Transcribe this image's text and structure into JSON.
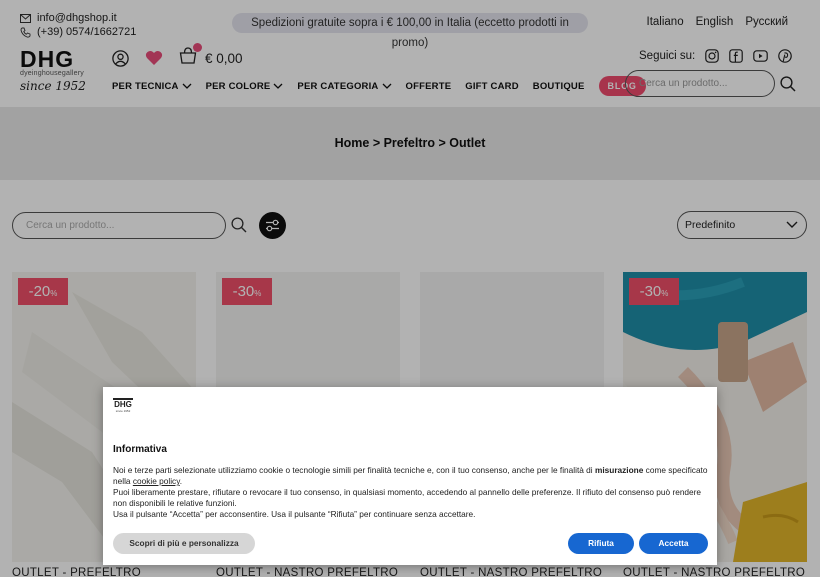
{
  "topbar": {
    "email": "info@dhgshop.it",
    "phone": "(+39) 0574/1662721",
    "promo": "Spedizioni gratuite sopra i € 100,00 in Italia (eccetto prodotti in promo)",
    "languages": [
      "Italiano",
      "English",
      "Русский"
    ]
  },
  "logo": {
    "brand": "DHG",
    "subtitle": "dyeinghousegallery",
    "since": "since 1952"
  },
  "header": {
    "cart_total": "€ 0,00",
    "follow_label": "Seguici su:",
    "social_icons": [
      "instagram-icon",
      "facebook-icon",
      "youtube-icon",
      "pinterest-icon"
    ],
    "search_placeholder": "Cerca un prodotto..."
  },
  "nav": {
    "items": [
      "PER TECNICA",
      "PER COLORE",
      "PER CATEGORIA",
      "OFFERTE",
      "GIFT CARD",
      "BOUTIQUE"
    ],
    "blog": "BLOG"
  },
  "breadcrumb": "Home > Prefeltro > Outlet",
  "listing": {
    "search_placeholder": "Cerca un prodotto...",
    "sort_selected": "Predefinito"
  },
  "products": [
    {
      "discount": "-20",
      "pct": "%",
      "title": "OUTLET - PREFELTRO"
    },
    {
      "discount": "-30",
      "pct": "%",
      "title": "OUTLET - NASTRO PREFELTRO"
    },
    {
      "discount": "",
      "pct": "",
      "title": "OUTLET - NASTRO PREFELTRO"
    },
    {
      "discount": "-30",
      "pct": "%",
      "title": "OUTLET - NASTRO PREFELTRO"
    }
  ],
  "cookie": {
    "logo_text": "DHG",
    "title": "Informativa",
    "p1_a": "Noi e terze parti selezionate utilizziamo cookie o tecnologie simili per finalità tecniche e, con il tuo consenso, anche per le finalità di ",
    "p1_b": "misurazione",
    "p1_c": " come specificato nella ",
    "p1_link": "cookie policy",
    "p1_end": ".",
    "p2": "Puoi liberamente prestare, rifiutare o revocare il tuo consenso, in qualsiasi momento, accedendo al pannello delle preferenze. Il rifiuto del consenso può rendere non disponibili le relative funzioni.",
    "p3": "Usa il pulsante “Accetta” per acconsentire. Usa il pulsante “Rifiuta” per continuare senza accettare.",
    "btn_more": "Scopri di più e personalizza",
    "btn_reject": "Rifiuta",
    "btn_accept": "Accetta"
  },
  "colors": {
    "accent_pink": "#ef4b6e",
    "cookie_blue": "#1767d1"
  }
}
